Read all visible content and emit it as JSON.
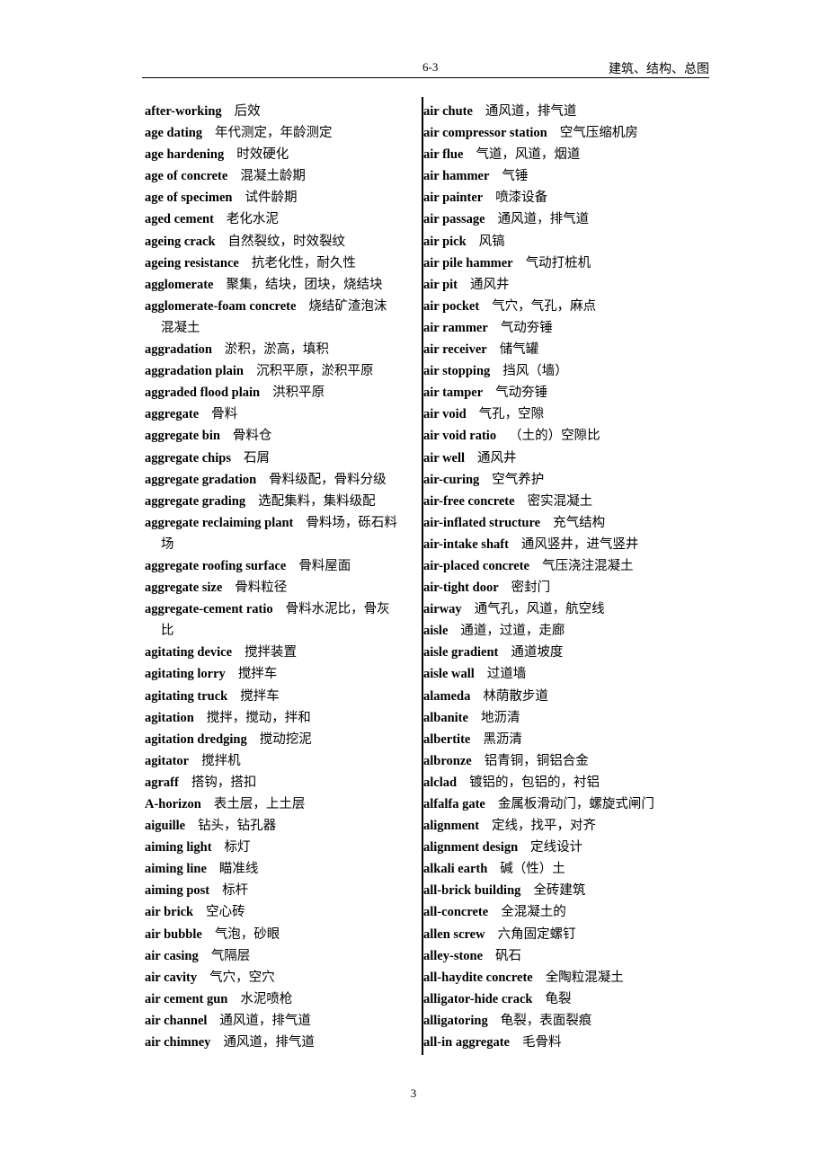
{
  "header": {
    "code": "6-3",
    "title": "建筑、结构、总图"
  },
  "left_column": [
    {
      "term": "after-working",
      "def": "后效"
    },
    {
      "term": "age dating",
      "def": "年代测定，年龄测定"
    },
    {
      "term": "age hardening",
      "def": "时效硬化"
    },
    {
      "term": "age of concrete",
      "def": "混凝土龄期"
    },
    {
      "term": "age of specimen",
      "def": "试件龄期"
    },
    {
      "term": "aged cement",
      "def": "老化水泥"
    },
    {
      "term": "ageing crack",
      "def": "自然裂纹，时效裂纹"
    },
    {
      "term": "ageing resistance",
      "def": "抗老化性，耐久性"
    },
    {
      "term": "agglomerate",
      "def": "聚集，结块，团块，烧结块"
    },
    {
      "term": "agglomerate-foam concrete",
      "def": "烧结矿渣泡沫",
      "cont": "混凝土"
    },
    {
      "term": "aggradation",
      "def": "淤积，淤高，填积"
    },
    {
      "term": "aggradation plain",
      "def": "沉积平原，淤积平原"
    },
    {
      "term": "aggraded flood plain",
      "def": "洪积平原"
    },
    {
      "term": "aggregate",
      "def": "骨料"
    },
    {
      "term": "aggregate bin",
      "def": "骨料仓"
    },
    {
      "term": "aggregate chips",
      "def": "石屑"
    },
    {
      "term": "aggregate gradation",
      "def": "骨料级配，骨料分级"
    },
    {
      "term": "aggregate grading",
      "def": "选配集料，集料级配"
    },
    {
      "term": "aggregate reclaiming plant",
      "def": "骨料场，砾石料",
      "cont": "场"
    },
    {
      "term": "aggregate roofing surface",
      "def": "骨料屋面"
    },
    {
      "term": "aggregate size",
      "def": "骨料粒径"
    },
    {
      "term": "aggregate-cement ratio",
      "def": "骨料水泥比，骨灰",
      "cont": "比"
    },
    {
      "term": "agitating device",
      "def": "搅拌装置"
    },
    {
      "term": "agitating lorry",
      "def": "搅拌车"
    },
    {
      "term": "agitating truck",
      "def": "搅拌车"
    },
    {
      "term": "agitation",
      "def": "搅拌，搅动，拌和"
    },
    {
      "term": "agitation dredging",
      "def": "搅动挖泥"
    },
    {
      "term": "agitator",
      "def": "搅拌机"
    },
    {
      "term": "agraff",
      "def": "搭钩，搭扣"
    },
    {
      "term": "A-horizon",
      "def": "表土层，上土层"
    },
    {
      "term": "aiguille",
      "def": "钻头，钻孔器"
    },
    {
      "term": "aiming light",
      "def": "标灯"
    },
    {
      "term": "aiming line",
      "def": "瞄准线"
    },
    {
      "term": "aiming post",
      "def": "标杆"
    },
    {
      "term": "air brick",
      "def": "空心砖"
    },
    {
      "term": "air bubble",
      "def": "气泡，砂眼"
    },
    {
      "term": "air casing",
      "def": "气隔层"
    },
    {
      "term": "air cavity",
      "def": "气穴，空穴"
    },
    {
      "term": "air cement gun",
      "def": "水泥喷枪"
    },
    {
      "term": "air channel",
      "def": "通风道，排气道"
    },
    {
      "term": "air chimney",
      "def": "通风道，排气道"
    }
  ],
  "right_column": [
    {
      "term": "air chute",
      "def": "通风道，排气道"
    },
    {
      "term": "air compressor station",
      "def": "空气压缩机房"
    },
    {
      "term": "air flue",
      "def": "气道，风道，烟道"
    },
    {
      "term": "air hammer",
      "def": "气锤"
    },
    {
      "term": "air painter",
      "def": "喷漆设备"
    },
    {
      "term": "air passage",
      "def": "通风道，排气道"
    },
    {
      "term": "air pick",
      "def": "风镐"
    },
    {
      "term": "air pile hammer",
      "def": "气动打桩机"
    },
    {
      "term": "air pit",
      "def": "通风井"
    },
    {
      "term": "air pocket",
      "def": "气穴，气孔，麻点"
    },
    {
      "term": "air rammer",
      "def": "气动夯锤"
    },
    {
      "term": "air receiver",
      "def": "储气罐"
    },
    {
      "term": "air stopping",
      "def": "挡风（墙）"
    },
    {
      "term": "air tamper",
      "def": "气动夯锤"
    },
    {
      "term": "air void",
      "def": "气孔，空隙"
    },
    {
      "term": "air void ratio",
      "def": "（土的）空隙比"
    },
    {
      "term": "air well",
      "def": "通风井"
    },
    {
      "term": "air-curing",
      "def": "空气养护"
    },
    {
      "term": "air-free concrete",
      "def": "密实混凝土"
    },
    {
      "term": "air-inflated structure",
      "def": "充气结构"
    },
    {
      "term": "air-intake shaft",
      "def": "通风竖井，进气竖井"
    },
    {
      "term": "air-placed concrete",
      "def": "气压浇注混凝土"
    },
    {
      "term": "air-tight door",
      "def": "密封门"
    },
    {
      "term": "airway",
      "def": "通气孔，风道，航空线"
    },
    {
      "term": "aisle",
      "def": "通道，过道，走廊"
    },
    {
      "term": "aisle gradient",
      "def": "通道坡度"
    },
    {
      "term": "aisle wall",
      "def": "过道墙"
    },
    {
      "term": "alameda",
      "def": "林荫散步道"
    },
    {
      "term": "albanite",
      "def": "地沥清"
    },
    {
      "term": "albertite",
      "def": "黑沥清"
    },
    {
      "term": "albronze",
      "def": "铝青铜，铜铝合金"
    },
    {
      "term": "alclad",
      "def": "镀铝的，包铝的，衬铝"
    },
    {
      "term": "alfalfa gate",
      "def": "金属板滑动门，螺旋式闸门"
    },
    {
      "term": "alignment",
      "def": "定线，找平，对齐"
    },
    {
      "term": "alignment design",
      "def": "定线设计"
    },
    {
      "term": "alkali earth",
      "def": "碱（性）土"
    },
    {
      "term": "all-brick building",
      "def": "全砖建筑"
    },
    {
      "term": "all-concrete",
      "def": "全混凝土的"
    },
    {
      "term": "allen screw",
      "def": "六角固定螺钉"
    },
    {
      "term": "alley-stone",
      "def": "矾石"
    },
    {
      "term": "all-haydite concrete",
      "def": "全陶粒混凝土"
    },
    {
      "term": "alligator-hide crack",
      "def": "龟裂"
    },
    {
      "term": "alligatoring",
      "def": "龟裂，表面裂痕"
    },
    {
      "term": "all-in aggregate",
      "def": "毛骨料"
    }
  ],
  "footer": {
    "page_number": "3"
  }
}
